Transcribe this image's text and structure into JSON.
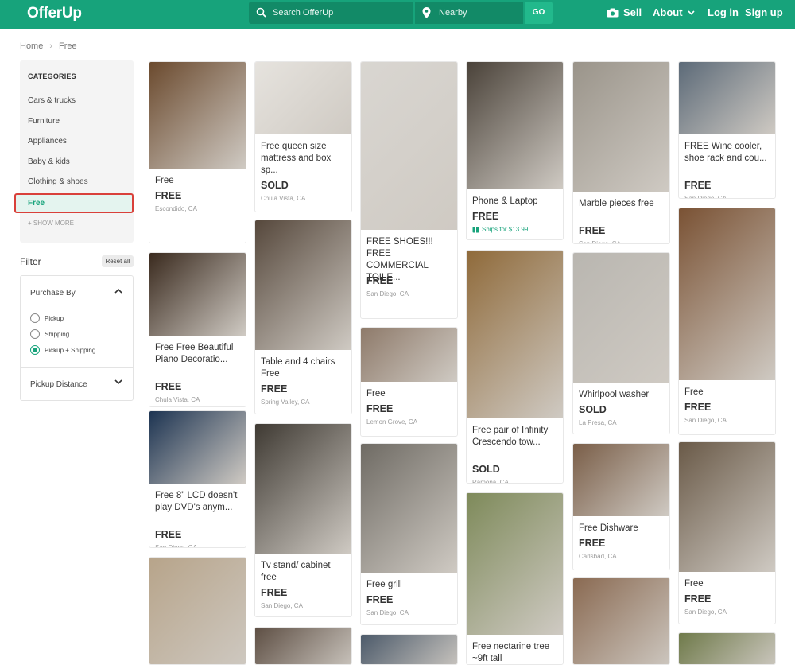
{
  "header": {
    "logo": "OfferUp",
    "search_placeholder": "Search OfferUp",
    "location_placeholder": "Nearby",
    "go_label": "GO",
    "sell_label": "Sell",
    "about_label": "About",
    "login_label": "Log in",
    "signup_label": "Sign up",
    "brand_color": "#17a37b"
  },
  "breadcrumb": {
    "home": "Home",
    "current": "Free"
  },
  "categories": {
    "title": "CATEGORIES",
    "items": [
      "Cars & trucks",
      "Furniture",
      "Appliances",
      "Baby & kids",
      "Clothing & shoes"
    ],
    "selected": "Free",
    "show_more": "+ SHOW MORE"
  },
  "filter": {
    "title": "Filter",
    "reset_label": "Reset all",
    "purchase_by": "Purchase By",
    "options": [
      "Pickup",
      "Shipping",
      "Pickup + Shipping"
    ],
    "selected_option": "Pickup + Shipping",
    "pickup_distance": "Pickup Distance"
  },
  "listings": [
    {
      "title": "Free",
      "price": "FREE",
      "location": "Escondido, CA",
      "color": "#6b4a2e"
    },
    {
      "title": "Free Free Beautiful Piano Decoratio...",
      "price": "FREE",
      "location": "Chula Vista, CA",
      "color": "#3a2a1e"
    },
    {
      "title": "Free 8\" LCD doesn't play DVD's anym...",
      "price": "FREE",
      "location": "San Diego, CA",
      "color": "#1d3452"
    },
    {
      "title": "",
      "price": "",
      "location": "",
      "color": "#b7a48a"
    },
    {
      "title": "Free queen size mattress and box sp...",
      "price": "SOLD",
      "location": "Chula Vista, CA",
      "color": "#e6e3de"
    },
    {
      "title": "Table and 4 chairs Free",
      "price": "FREE",
      "location": "Spring Valley, CA",
      "color": "#56483c"
    },
    {
      "title": "Tv stand/ cabinet free",
      "price": "FREE",
      "location": "San Diego, CA",
      "color": "#3f3a33"
    },
    {
      "title": "",
      "price": "",
      "location": "",
      "color": "#5e4f44"
    },
    {
      "title": "FREE SHOES!!! FREE COMMERCIAL TOILE...",
      "price": "FREE",
      "location": "San Diego, CA",
      "color": "#d9d6d1"
    },
    {
      "title": "Free",
      "price": "FREE",
      "location": "Lemon Grove, CA",
      "color": "#8e7a6a"
    },
    {
      "title": "Free grill",
      "price": "FREE",
      "location": "San Diego, CA",
      "color": "#6f6b64"
    },
    {
      "title": "",
      "price": "",
      "location": "",
      "color": "#4c5a6a"
    },
    {
      "title": "Phone & Laptop",
      "price": "FREE",
      "location": "",
      "shipping": "Ships for $13.99",
      "color": "#4a4239"
    },
    {
      "title": "Free pair of Infinity Crescendo tow...",
      "price": "SOLD",
      "location": "Ramona, CA",
      "color": "#8f6a3a"
    },
    {
      "title": "Free nectarine tree ~9ft tall",
      "price": "",
      "location": "",
      "color": "#7e8a5a"
    },
    {
      "title": "Marble pieces free",
      "price": "FREE",
      "location": "San Diego, CA",
      "color": "#9a948a"
    },
    {
      "title": "Whirlpool washer",
      "price": "SOLD",
      "location": "La Presa, CA",
      "color": "#b9b6b0"
    },
    {
      "title": "Free Dishware",
      "price": "FREE",
      "location": "Carlsbad, CA",
      "color": "#7a5e48"
    },
    {
      "title": "",
      "price": "",
      "location": "",
      "color": "#8a6a52"
    },
    {
      "title": "FREE Wine cooler, shoe rack and cou...",
      "price": "FREE",
      "location": "San Diego, CA",
      "color": "#5c6a78"
    },
    {
      "title": "Free",
      "price": "FREE",
      "location": "San Diego, CA",
      "color": "#7a5234"
    },
    {
      "title": "Free",
      "price": "FREE",
      "location": "San Diego, CA",
      "color": "#6a5a48"
    },
    {
      "title": "",
      "price": "",
      "location": "",
      "color": "#6f7a4a"
    }
  ]
}
